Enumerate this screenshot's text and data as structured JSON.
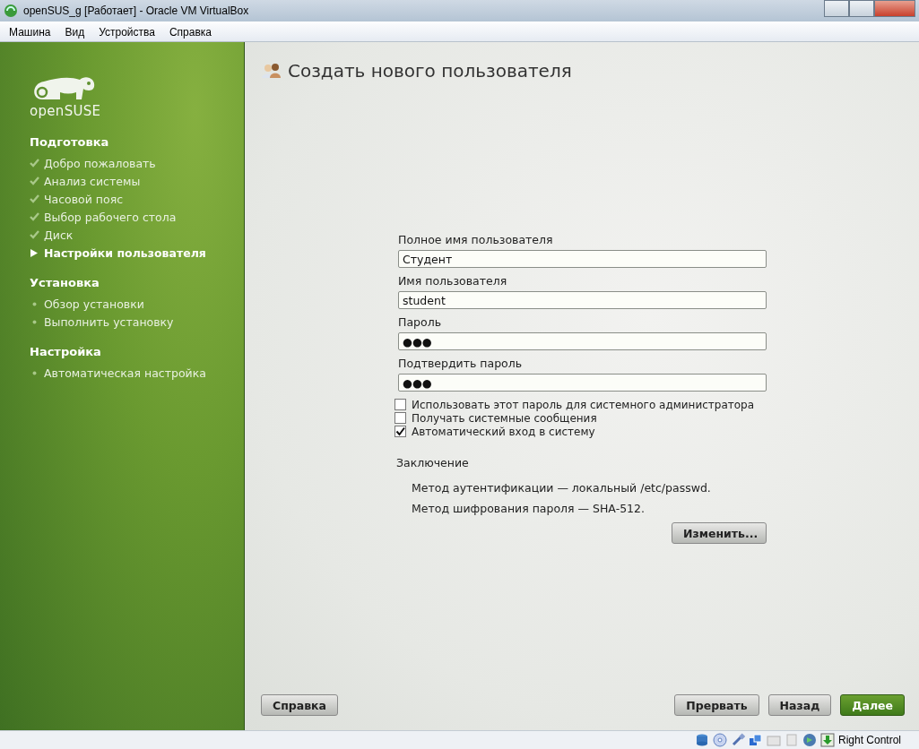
{
  "window": {
    "title": "openSUS_g [Работает] - Oracle VM VirtualBox"
  },
  "menu": [
    "Машина",
    "Вид",
    "Устройства",
    "Справка"
  ],
  "sidebar": {
    "logo_text": "openSUSE",
    "sections": [
      {
        "title": "Подготовка",
        "items": [
          {
            "label": "Добро пожаловать",
            "kind": "done"
          },
          {
            "label": "Анализ системы",
            "kind": "done"
          },
          {
            "label": "Часовой пояс",
            "kind": "done"
          },
          {
            "label": "Выбор рабочего стола",
            "kind": "done"
          },
          {
            "label": "Диск",
            "kind": "done"
          },
          {
            "label": "Настройки пользователя",
            "kind": "current"
          }
        ]
      },
      {
        "title": "Установка",
        "items": [
          {
            "label": "Обзор установки",
            "kind": "pending"
          },
          {
            "label": "Выполнить установку",
            "kind": "pending"
          }
        ]
      },
      {
        "title": "Настройка",
        "items": [
          {
            "label": "Автоматическая настройка",
            "kind": "pending"
          }
        ]
      }
    ]
  },
  "page": {
    "title": "Создать нового пользователя",
    "fields": [
      {
        "label": "Полное имя пользователя",
        "value": "Студент"
      },
      {
        "label": "Имя пользователя",
        "value": "student"
      },
      {
        "label": "Пароль",
        "value": "●●●"
      },
      {
        "label": "Подтвердить пароль",
        "value": "●●●"
      }
    ],
    "checkboxes": [
      {
        "label": "Использовать этот пароль для системного администратора",
        "checked": false
      },
      {
        "label": "Получать системные сообщения",
        "checked": false
      },
      {
        "label": "Автоматический вход в систему",
        "checked": true
      }
    ],
    "summary": {
      "title": "Заключение",
      "lines": [
        "Метод аутентификации — локальный /etc/passwd.",
        "Метод шифрования пароля — SHA-512."
      ],
      "button": "Изменить..."
    }
  },
  "buttons": [
    {
      "label": "Справка",
      "kind": "default"
    },
    {
      "label": "Прервать",
      "kind": "default"
    },
    {
      "label": "Назад",
      "kind": "default"
    },
    {
      "label": "Далее",
      "kind": "primary"
    }
  ],
  "status_bar": {
    "host_key": "Right Control"
  }
}
